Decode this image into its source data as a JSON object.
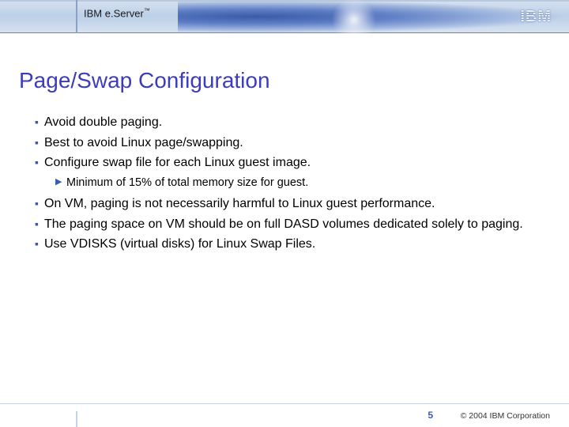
{
  "header": {
    "brand_prefix": "IBM e.",
    "brand_thin": "Server",
    "brand_tm": "™",
    "logo_text": "IBM"
  },
  "title": "Page/Swap Configuration",
  "bullets": {
    "b0": "Avoid double paging.",
    "b1": "Best to avoid Linux page/swapping.",
    "b2": "Configure swap file for each Linux guest image.",
    "s0": "Minimum of 15% of total memory size for guest.",
    "b3": "On VM, paging is not necessarily harmful to Linux guest performance.",
    "b4": "The paging space on VM should be on full DASD volumes dedicated solely to paging.",
    "b5": "Use VDISKS (virtual disks) for Linux Swap Files."
  },
  "footer": {
    "page": "5",
    "copyright": "© 2004 IBM Corporation"
  }
}
